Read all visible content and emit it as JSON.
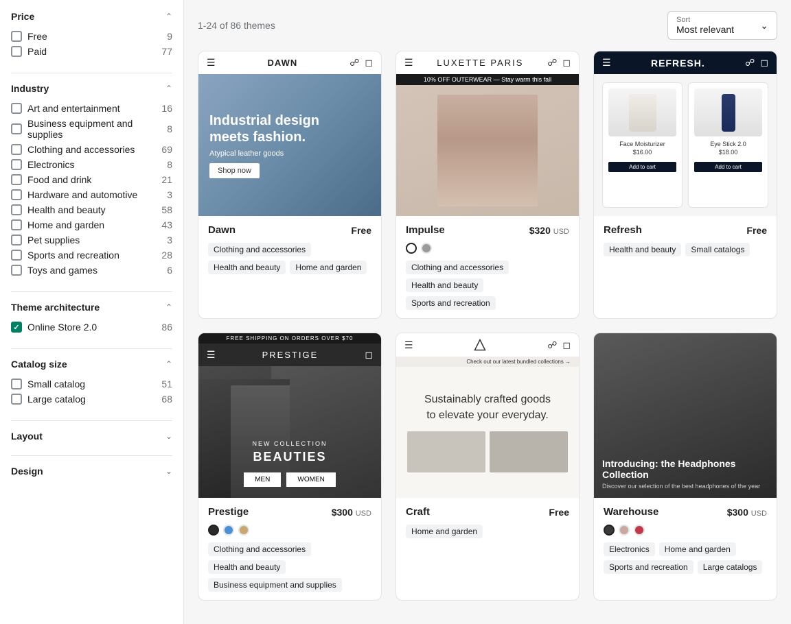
{
  "sidebar": {
    "sections": [
      {
        "id": "price",
        "title": "Price",
        "expanded": true,
        "filters": [
          {
            "id": "free",
            "label": "Free",
            "count": 9,
            "checked": false
          },
          {
            "id": "paid",
            "label": "Paid",
            "count": 77,
            "checked": false
          }
        ]
      },
      {
        "id": "industry",
        "title": "Industry",
        "expanded": true,
        "filters": [
          {
            "id": "art",
            "label": "Art and entertainment",
            "count": 16,
            "checked": false
          },
          {
            "id": "business",
            "label": "Business equipment and supplies",
            "count": 8,
            "checked": false
          },
          {
            "id": "clothing",
            "label": "Clothing and accessories",
            "count": 69,
            "checked": false
          },
          {
            "id": "electronics",
            "label": "Electronics",
            "count": 8,
            "checked": false
          },
          {
            "id": "food",
            "label": "Food and drink",
            "count": 21,
            "checked": false
          },
          {
            "id": "hardware",
            "label": "Hardware and automotive",
            "count": 3,
            "checked": false
          },
          {
            "id": "health",
            "label": "Health and beauty",
            "count": 58,
            "checked": false
          },
          {
            "id": "home",
            "label": "Home and garden",
            "count": 43,
            "checked": false
          },
          {
            "id": "pet",
            "label": "Pet supplies",
            "count": 3,
            "checked": false
          },
          {
            "id": "sports",
            "label": "Sports and recreation",
            "count": 28,
            "checked": false
          },
          {
            "id": "toys",
            "label": "Toys and games",
            "count": 6,
            "checked": false
          }
        ]
      },
      {
        "id": "theme_arch",
        "title": "Theme architecture",
        "expanded": true,
        "filters": [
          {
            "id": "online2",
            "label": "Online Store 2.0",
            "count": 86,
            "checked": true
          }
        ]
      },
      {
        "id": "catalog_size",
        "title": "Catalog size",
        "expanded": true,
        "filters": [
          {
            "id": "small_cat",
            "label": "Small catalog",
            "count": 51,
            "checked": false
          },
          {
            "id": "large_cat",
            "label": "Large catalog",
            "count": 68,
            "checked": false
          }
        ]
      },
      {
        "id": "layout",
        "title": "Layout",
        "expanded": false,
        "filters": []
      },
      {
        "id": "design",
        "title": "Design",
        "expanded": false,
        "filters": []
      }
    ]
  },
  "main": {
    "results_count": "1-24 of 86 themes",
    "sort": {
      "label": "Sort",
      "value": "Most relevant"
    },
    "themes": [
      {
        "id": "dawn",
        "name": "Dawn",
        "price": "Free",
        "is_free": true,
        "swatches": [],
        "tags": [
          "Clothing and accessories",
          "Health and beauty",
          "Home and garden"
        ],
        "preview_type": "dawn"
      },
      {
        "id": "impulse",
        "name": "Impulse",
        "price": "$320",
        "currency": "USD",
        "is_free": false,
        "swatches": [
          {
            "color": "#ffffff",
            "selected": true
          },
          {
            "color": "#9a9a9a",
            "selected": false
          }
        ],
        "tags": [
          "Clothing and accessories",
          "Health and beauty",
          "Sports and recreation"
        ],
        "preview_type": "luxette"
      },
      {
        "id": "refresh",
        "name": "Refresh",
        "price": "Free",
        "is_free": true,
        "swatches": [],
        "tags": [
          "Health and beauty",
          "Small catalogs"
        ],
        "preview_type": "refresh"
      },
      {
        "id": "prestige",
        "name": "Prestige",
        "price": "$300",
        "currency": "USD",
        "is_free": false,
        "swatches": [
          {
            "color": "#2a2a2a",
            "selected": true
          },
          {
            "color": "#4a90d9",
            "selected": false
          },
          {
            "color": "#c8a86e",
            "selected": false
          }
        ],
        "tags": [
          "Clothing and accessories",
          "Health and beauty",
          "Business equipment and supplies"
        ],
        "preview_type": "prestige"
      },
      {
        "id": "craft",
        "name": "Craft",
        "price": "Free",
        "is_free": true,
        "swatches": [],
        "tags": [
          "Home and garden"
        ],
        "preview_type": "craft"
      },
      {
        "id": "warehouse",
        "name": "Warehouse",
        "price": "$300",
        "currency": "USD",
        "is_free": false,
        "swatches": [
          {
            "color": "#3a3a3a",
            "selected": true
          },
          {
            "color": "#c8a8a0",
            "selected": false
          },
          {
            "color": "#c0384a",
            "selected": false
          }
        ],
        "tags": [
          "Electronics",
          "Home and garden",
          "Sports and recreation",
          "Large catalogs"
        ],
        "preview_type": "warehouse"
      }
    ]
  }
}
